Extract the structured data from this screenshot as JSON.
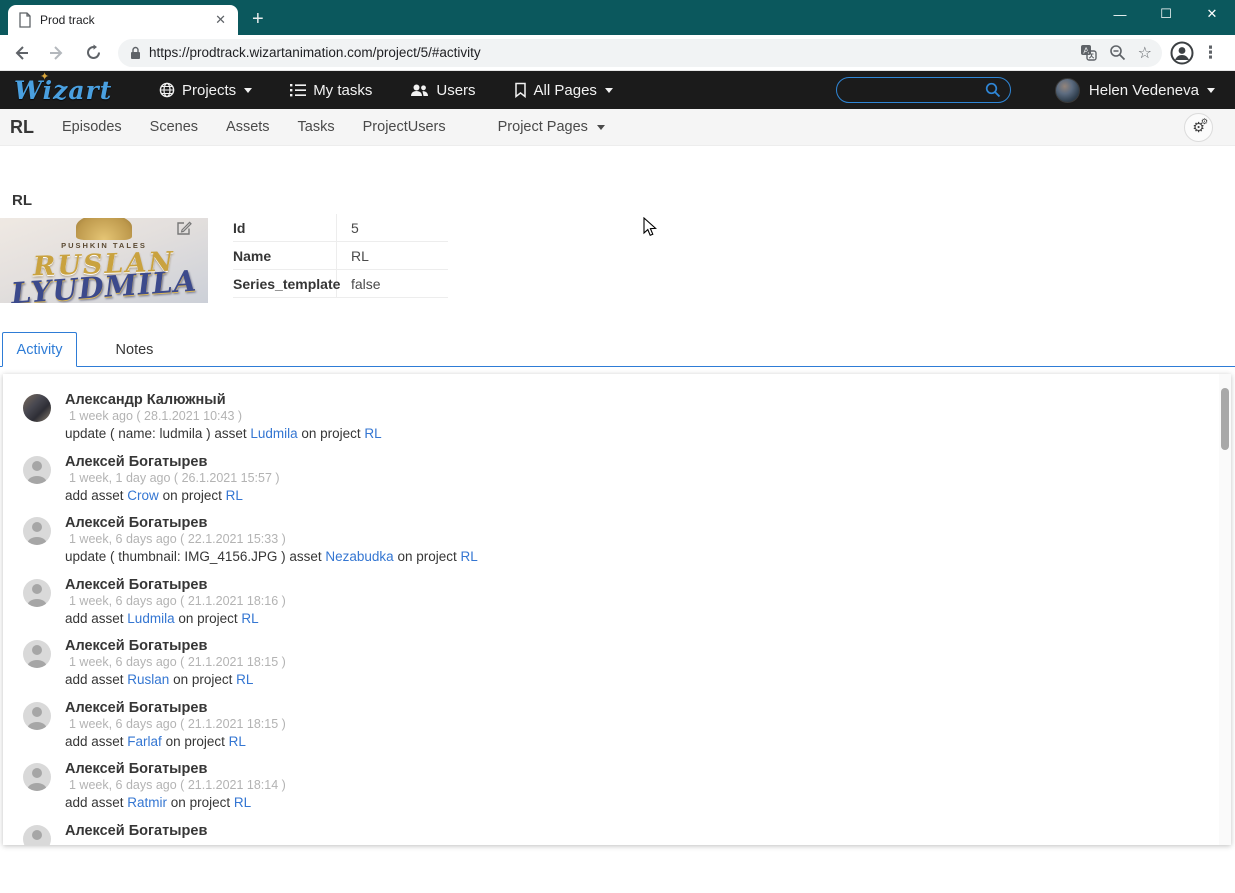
{
  "browser": {
    "tab_title": "Prod track",
    "url": "https://prodtrack.wizartanimation.com/project/5/#activity"
  },
  "navbar": {
    "logo_text": "Wizart",
    "items": [
      {
        "label": "Projects",
        "icon": "globe-icon",
        "has_dropdown": true
      },
      {
        "label": "My tasks",
        "icon": "tasks-icon",
        "has_dropdown": false
      },
      {
        "label": "Users",
        "icon": "users-icon",
        "has_dropdown": false
      },
      {
        "label": "All Pages",
        "icon": "bookmark-icon",
        "has_dropdown": true
      }
    ],
    "search_placeholder": "",
    "user_name": "Helen Vedeneva"
  },
  "project_nav": {
    "brand": "RL",
    "items": [
      "Episodes",
      "Scenes",
      "Assets",
      "Tasks",
      "ProjectUsers"
    ],
    "dropdown_label": "Project Pages"
  },
  "page": {
    "title": "RL",
    "poster": {
      "series_label": "PUSHKIN TALES",
      "title_line1": "RUSLAN",
      "title_line2": "LYUDMILA"
    },
    "fields": [
      {
        "label": "Id",
        "value": "5"
      },
      {
        "label": "Name",
        "value": "RL"
      },
      {
        "label": "Series_template",
        "value": "false"
      }
    ]
  },
  "tabs": {
    "activity": "Activity",
    "notes": "Notes"
  },
  "activity": [
    {
      "name": "Александр Калюжный",
      "time": "1 week ago ( 28.1.2021 10:43 )",
      "avatar": "photo",
      "action": {
        "pre": "update ( name: ludmila ) asset ",
        "asset": "Ludmila",
        "mid": " on project ",
        "project": "RL"
      }
    },
    {
      "name": "Алексей Богатырев",
      "time": "1 week, 1 day ago ( 26.1.2021 15:57 )",
      "avatar": "default",
      "action": {
        "pre": "add asset ",
        "asset": "Crow",
        "mid": " on project ",
        "project": "RL"
      }
    },
    {
      "name": "Алексей Богатырев",
      "time": "1 week, 6 days ago ( 22.1.2021 15:33 )",
      "avatar": "default",
      "action": {
        "pre": "update ( thumbnail: IMG_4156.JPG ) asset ",
        "asset": "Nezabudka",
        "mid": " on project ",
        "project": "RL"
      }
    },
    {
      "name": "Алексей Богатырев",
      "time": "1 week, 6 days ago ( 21.1.2021 18:16 )",
      "avatar": "default",
      "action": {
        "pre": "add asset ",
        "asset": "Ludmila",
        "mid": " on project ",
        "project": "RL"
      }
    },
    {
      "name": "Алексей Богатырев",
      "time": "1 week, 6 days ago ( 21.1.2021 18:15 )",
      "avatar": "default",
      "action": {
        "pre": "add asset ",
        "asset": "Ruslan",
        "mid": " on project ",
        "project": "RL"
      }
    },
    {
      "name": "Алексей Богатырев",
      "time": "1 week, 6 days ago ( 21.1.2021 18:15 )",
      "avatar": "default",
      "action": {
        "pre": "add asset ",
        "asset": "Farlaf",
        "mid": " on project ",
        "project": "RL"
      }
    },
    {
      "name": "Алексей Богатырев",
      "time": "1 week, 6 days ago ( 21.1.2021 18:14 )",
      "avatar": "default",
      "action": {
        "pre": "add asset ",
        "asset": "Ratmir",
        "mid": " on project ",
        "project": "RL"
      }
    },
    {
      "name": "Алексей Богатырев",
      "time": null,
      "avatar": "default",
      "action": null
    }
  ],
  "colors": {
    "browser_theme": "#0b585d",
    "app_navbar_bg": "#1b1b1b",
    "accent_link": "#3476d2",
    "tab_active_blue": "#2e7cd6"
  }
}
